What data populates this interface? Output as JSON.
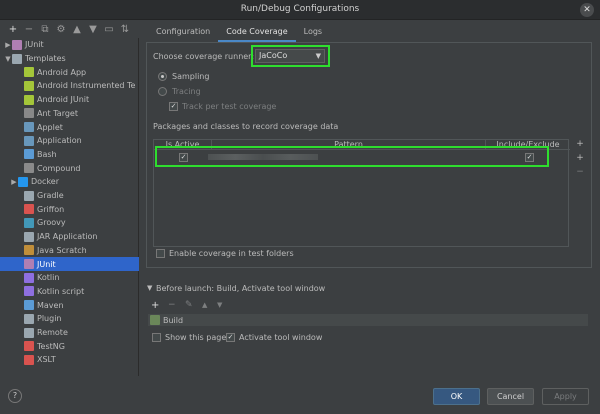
{
  "window": {
    "title": "Run/Debug Configurations",
    "close_glyph": "✕"
  },
  "toolbar": {
    "add": "+",
    "remove": "−",
    "copy": "⧉",
    "settings": "⚙",
    "up": "▲",
    "down": "▼",
    "folder": "▭",
    "sort": "⇅"
  },
  "tree": {
    "items": [
      {
        "label": "JUnit",
        "arrow": "▶",
        "icon": "junit-icon",
        "color": "#b07fb3",
        "indent": 0
      },
      {
        "label": "Templates",
        "arrow": "▼",
        "icon": "wrench-icon",
        "color": "#9aa7b0",
        "indent": 0
      },
      {
        "label": "Android App",
        "arrow": "",
        "icon": "android-app-icon",
        "color": "#a4c639",
        "indent": 2
      },
      {
        "label": "Android Instrumented Te",
        "arrow": "",
        "icon": "android-test-icon",
        "color": "#a4c639",
        "indent": 2
      },
      {
        "label": "Android JUnit",
        "arrow": "",
        "icon": "android-junit-icon",
        "color": "#a4c639",
        "indent": 2
      },
      {
        "label": "Ant Target",
        "arrow": "",
        "icon": "ant-icon",
        "color": "#888888",
        "indent": 2
      },
      {
        "label": "Applet",
        "arrow": "",
        "icon": "applet-icon",
        "color": "#6897bb",
        "indent": 2
      },
      {
        "label": "Application",
        "arrow": "",
        "icon": "application-icon",
        "color": "#6897bb",
        "indent": 2
      },
      {
        "label": "Bash",
        "arrow": "",
        "icon": "bash-icon",
        "color": "#5b9bd5",
        "indent": 2
      },
      {
        "label": "Compound",
        "arrow": "",
        "icon": "compound-icon",
        "color": "#8a8a8a",
        "indent": 2
      },
      {
        "label": "Docker",
        "arrow": "▶",
        "icon": "docker-icon",
        "color": "#2496ed",
        "indent": 1
      },
      {
        "label": "Gradle",
        "arrow": "",
        "icon": "gradle-icon",
        "color": "#9aa7b0",
        "indent": 2
      },
      {
        "label": "Griffon",
        "arrow": "",
        "icon": "griffon-icon",
        "color": "#d9534f",
        "indent": 2
      },
      {
        "label": "Groovy",
        "arrow": "",
        "icon": "groovy-icon",
        "color": "#4298b8",
        "indent": 2
      },
      {
        "label": "JAR Application",
        "arrow": "",
        "icon": "jar-icon",
        "color": "#9aa7b0",
        "indent": 2
      },
      {
        "label": "Java Scratch",
        "arrow": "",
        "icon": "java-scratch-icon",
        "color": "#c08e3a",
        "indent": 2
      },
      {
        "label": "JUnit",
        "arrow": "",
        "icon": "junit-icon",
        "color": "#b07fb3",
        "indent": 2,
        "selected": true
      },
      {
        "label": "Kotlin",
        "arrow": "",
        "icon": "kotlin-icon",
        "color": "#8e6fe0",
        "indent": 2
      },
      {
        "label": "Kotlin script",
        "arrow": "",
        "icon": "kotlin-script-icon",
        "color": "#8e6fe0",
        "indent": 2
      },
      {
        "label": "Maven",
        "arrow": "",
        "icon": "maven-icon",
        "color": "#5b9bd5",
        "indent": 2
      },
      {
        "label": "Plugin",
        "arrow": "",
        "icon": "plugin-icon",
        "color": "#9aa7b0",
        "indent": 2
      },
      {
        "label": "Remote",
        "arrow": "",
        "icon": "remote-icon",
        "color": "#9aa7b0",
        "indent": 2
      },
      {
        "label": "TestNG",
        "arrow": "",
        "icon": "testng-icon",
        "color": "#d9534f",
        "indent": 2
      },
      {
        "label": "XSLT",
        "arrow": "",
        "icon": "xslt-icon",
        "color": "#d9534f",
        "indent": 2
      }
    ]
  },
  "tabs": {
    "configuration": "Configuration",
    "code_coverage": "Code Coverage",
    "logs": "Logs"
  },
  "coverage": {
    "runner_label": "Choose coverage runner:",
    "runner_value": "JaCoCo",
    "runner_dd": "▼",
    "sampling": "Sampling",
    "tracing": "Tracing",
    "track_per_test": "Track per test coverage",
    "packages_label": "Packages and classes to record coverage data",
    "col_active": "Is Active",
    "col_pattern": "Pattern",
    "col_include": "Include/Exclude",
    "check": "✓",
    "enable_in_tests": "Enable coverage in test folders",
    "add_class": "+",
    "add_package": "+",
    "remove": "−"
  },
  "before_launch": {
    "toggle": "▼",
    "label": "Before launch: Build, Activate tool window",
    "add": "+",
    "remove": "−",
    "edit": "✎",
    "up": "▲",
    "down": "▼",
    "build_item": "Build",
    "show_page": "Show this page",
    "activate_tool": "Activate tool window"
  },
  "buttons": {
    "help": "?",
    "ok": "OK",
    "cancel": "Cancel",
    "apply": "Apply"
  },
  "colors": {
    "highlight": "#2ede2e",
    "selection": "#2f65ca",
    "primary_button": "#365880"
  }
}
